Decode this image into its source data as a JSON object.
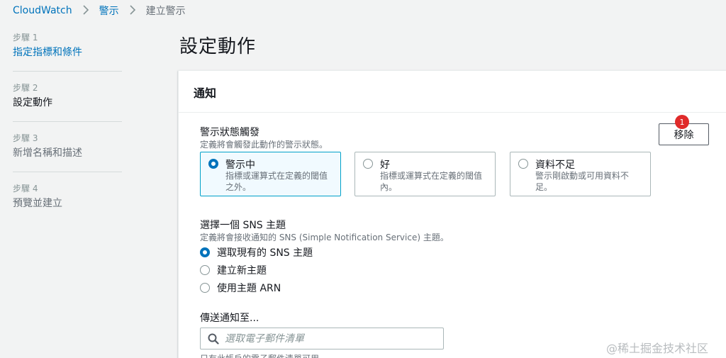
{
  "breadcrumb": {
    "root": "CloudWatch",
    "section": "警示",
    "current": "建立警示"
  },
  "steps": [
    {
      "num": "步驟 1",
      "label": "指定指標和條件"
    },
    {
      "num": "步驟 2",
      "label": "設定動作"
    },
    {
      "num": "步驟 3",
      "label": "新增名稱和描述"
    },
    {
      "num": "步驟 4",
      "label": "預覽並建立"
    }
  ],
  "page_title": "設定動作",
  "panel": {
    "title": "通知",
    "alarm_trigger": {
      "label": "警示狀態觸發",
      "desc": "定義將會觸發此動作的警示狀態。",
      "remove_label": "移除",
      "badge": "1",
      "options": [
        {
          "title": "警示中",
          "desc": "指標或運算式在定義的閾值之外。",
          "selected": true
        },
        {
          "title": "好",
          "desc": "指標或運算式在定義的閾值內。",
          "selected": false
        },
        {
          "title": "資料不足",
          "desc": "警示剛啟動或可用資料不足。",
          "selected": false
        }
      ]
    },
    "sns": {
      "label": "選擇一個 SNS 主題",
      "desc": "定義將會接收通知的 SNS (Simple Notification Service) 主題。",
      "options": [
        {
          "label": "選取現有的 SNS 主題",
          "selected": true
        },
        {
          "label": "建立新主題",
          "selected": false
        },
        {
          "label": "使用主題 ARN",
          "selected": false
        }
      ]
    },
    "send_to": {
      "label": "傳送通知至...",
      "placeholder": "選取電子郵件清單",
      "hint": "只有此帳戶的電子郵件清單可用。"
    }
  },
  "watermark": "@稀土掘金技术社区",
  "colors": {
    "link": "#0073bb",
    "accent": "#00a1c9",
    "badge": "#e02a2a"
  },
  "icons": {
    "separator": "chevron-right-icon",
    "search": "search-icon"
  }
}
